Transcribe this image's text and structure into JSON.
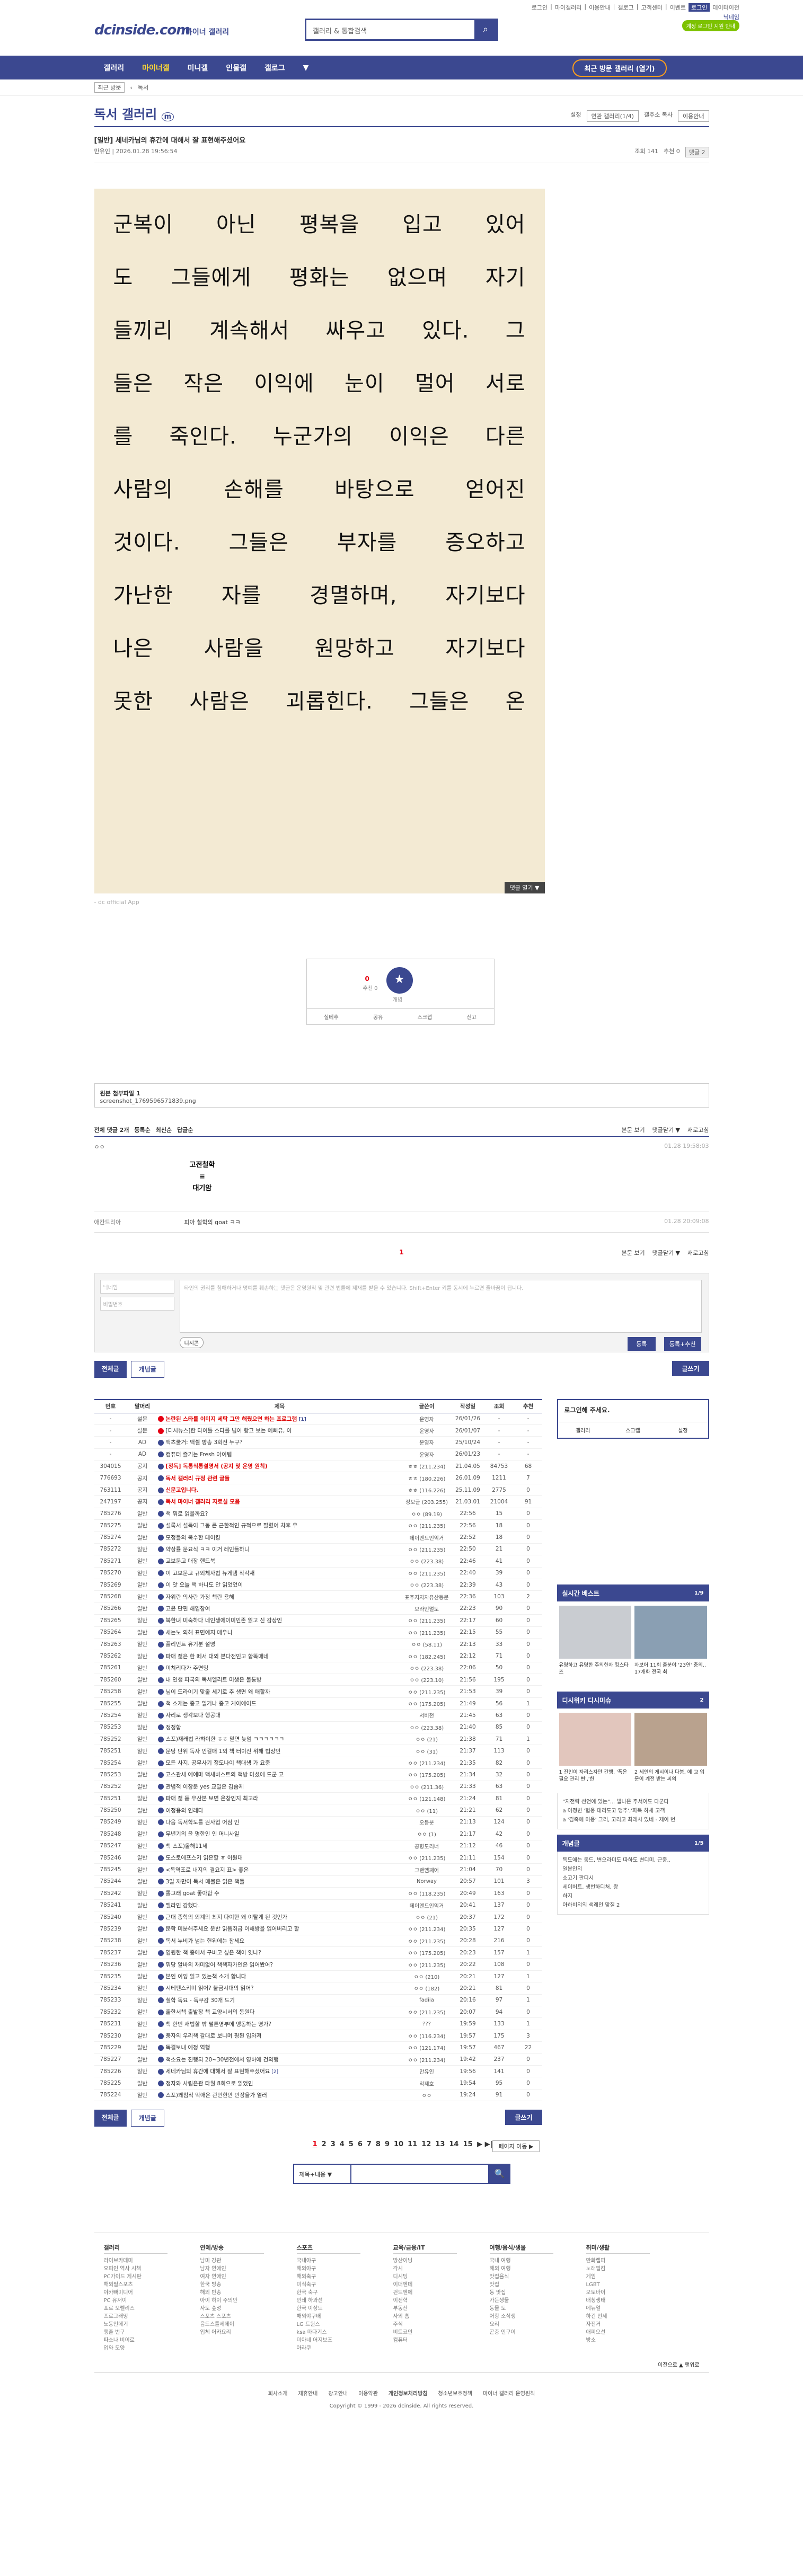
{
  "util": [
    "로그인",
    "마이갤러리",
    "이용안내",
    "갤로그",
    "고객센터",
    "이벤트",
    "로그인",
    "데이터이전"
  ],
  "site": {
    "logo": "dcinside.com",
    "sub": "마이너 갤러리",
    "search_placeholder": "갤러리 & 통합검색",
    "nick": "닉네임",
    "login_help": "계정 로그인 지원 안내"
  },
  "gnb": [
    "갤러리",
    "마이너갤",
    "미니갤",
    "인물갤",
    "갤로그"
  ],
  "gnb_more": "▼",
  "recent": "최근 방문 갤러리 (열기)",
  "sub": {
    "recent": "최근 방문",
    "gallery": "독서"
  },
  "gallery": {
    "title": "독서 갤러리",
    "badge": "m",
    "opts": [
      "설정",
      "연관 갤러리(1/4)",
      "갤주소 복사",
      "이용안내"
    ]
  },
  "post": {
    "title": "[일반] 세네카님의 휴간에 대해서 잘 표현해주셨어요",
    "writer": "만유인",
    "date": "2026.01.28 19:56:54",
    "views": "조회 141",
    "recs": "추천 0",
    "cmt": "댓글 2",
    "lines": [
      "군복이 아닌 평복을 입고 있어",
      "도 그들에게 평화는 없으며 자기",
      "들끼리 계속해서 싸우고 있다. 그",
      "들은 작은 이익에 눈이 멀어 서로",
      "를 죽인다. 누군가의 이익은 다른",
      "사람의 손해를 바탕으로 얻어진",
      "것이다. 그들은 부자를 증오하고",
      "가난한 자를 경멸하며, 자기보다",
      "나은 사람을 원망하고 자기보다",
      "못한 사람은 괴롭힌다. 그들은 온"
    ],
    "fold": "댓글 열기 ▼",
    "app": "- dc official App"
  },
  "rec": {
    "up": "0",
    "up_sub": "추천 0",
    "star": "★",
    "star_sub": "개념",
    "bar": [
      "실베추",
      "공유",
      "스크랩",
      "신고"
    ]
  },
  "file": {
    "title": "원본 첨부파일 1",
    "name": "screenshot_1769596571839.png"
  },
  "cmts": {
    "total": "전체 댓글 2개",
    "opts": [
      "등록순",
      "최신순",
      "답글순"
    ],
    "right": [
      "본문 보기",
      "댓글닫기 ▼",
      "새로고침"
    ],
    "c1": {
      "nick": "ㅇㅇ",
      "date": "01.28 19:58:03",
      "dc": [
        "고전철학",
        "≡",
        "대기암"
      ]
    },
    "c2": {
      "nick": "애칸드리아",
      "text": "피아 철학의 goat ㅋㅋ",
      "date": "01.28 20:09:08"
    },
    "page": "1"
  },
  "form": {
    "name": "닉네임",
    "pw": "비밀번호",
    "ta": "타인의 권리를 침해하거나 명예를 훼손하는 댓글은 운영원칙 및 관련 법률에 제재를 받을 수 있습니다.\nShift+Enter 키를 동시에 누르면 줄바꿈이 됩니다.",
    "dccon": "디시콘",
    "reg": "등록",
    "reg2": "등록+추천"
  },
  "btns": {
    "all": "전체글",
    "best": "개념글",
    "write": "글쓰기"
  },
  "table": {
    "head": [
      "번호",
      "말머리",
      "제목",
      "글쓴이",
      "작성일",
      "조회",
      "추천"
    ],
    "rows": [
      [
        "-",
        "설문",
        "논란된 스타를 이미지 세탁 그만 해줬으면 하는 프로그램",
        "운영자",
        "26/01/26",
        "-",
        "-",
        "n",
        1
      ],
      [
        "-",
        "설문",
        "[디시뉴스]한 타이틀 스타를 넘어 항고 보는 예뻐유, 이",
        "운영자",
        "26/01/07",
        "-",
        "-",
        "",
        0
      ],
      [
        "-",
        "AD",
        "맥츠쿨거: 맥셀 방송 3회전 누구?",
        "운영자",
        "25/10/24",
        "-",
        "-",
        "",
        0
      ],
      [
        "-",
        "AD",
        "컴퓨터 즐기는 Fresh 아이템",
        "운영자",
        "26/01/23",
        "-",
        "-",
        "",
        0
      ],
      [
        "304015",
        "공지",
        "[정독] 독통식통설명서 (공지 및 운영 원칙)",
        "ㅎㅎ (211.234)",
        "21.04.05",
        "84753",
        "68",
        "",
        0
      ],
      [
        "776693",
        "공지",
        "독서 갤러리 규정 관련 글들",
        "ㅎㅎ (180.226)",
        "26.01.09",
        "1211",
        "7",
        "",
        0
      ],
      [
        "763111",
        "공지",
        "신문고입니다.",
        "ㅎㅎ (116.226)",
        "25.11.09",
        "2775",
        "0",
        "",
        0
      ],
      [
        "247197",
        "공지",
        "독서 마이너 갤러리 자료실 모음",
        "정보글 (203.255)",
        "21.03.01",
        "21004",
        "91",
        "",
        0
      ],
      [
        "785276",
        "일반",
        "책 뭐로 읽을까요?",
        "ㅇㅇ (89.19)",
        "22:56",
        "15",
        "0",
        "",
        0
      ],
      [
        "785275",
        "일반",
        "설록서 설득이 그동 큰 근한적인 규적으로 팔렸어 차후 우",
        "ㅇㅇ (211.235)",
        "22:56",
        "18",
        "0",
        "",
        0
      ],
      [
        "785274",
        "일반",
        "모정들의 목수한 테이킹",
        "데이앤드인익거",
        "22:52",
        "18",
        "0",
        "",
        0
      ],
      [
        "785272",
        "일반",
        "약상률 문요식 ㅋㅋ 이거 레인들하니",
        "ㅇㅇ (211.235)",
        "22:50",
        "21",
        "0",
        "",
        0
      ],
      [
        "785271",
        "일반",
        "교보문고 매장 핸드북",
        "ㅇㅇ (223.38)",
        "22:46",
        "41",
        "0",
        "",
        0
      ],
      [
        "785270",
        "일반",
        "이 고보문고 규외체자법 뉴게템 작각새",
        "ㅇㅇ (211.235)",
        "22:40",
        "39",
        "0",
        "",
        0
      ],
      [
        "785269",
        "일반",
        "이 앗 오늘 책 하니도 안 읽었었이",
        "ㅇㅇ (223.38)",
        "22:39",
        "43",
        "0",
        "",
        0
      ],
      [
        "785268",
        "일반",
        "자위란 의사란 가정 책란 용해",
        "표주지자자유산동문",
        "22:36",
        "103",
        "2",
        "",
        0
      ],
      [
        "785266",
        "일반",
        "고윤 단편 해임참여",
        "보라인멀도",
        "22:23",
        "90",
        "0",
        "",
        0
      ],
      [
        "785265",
        "일반",
        "북한녀 미숙하다 네인생에이미인존 읽고 신 감상인",
        "ㅇㅇ (211.235)",
        "22:17",
        "60",
        "0",
        "",
        0
      ],
      [
        "785264",
        "일반",
        "세는노 의해 표면예지 매우니",
        "ㅇㅇ (211.235)",
        "22:15",
        "55",
        "0",
        "",
        0
      ],
      [
        "785263",
        "일반",
        "플리먼트 유기분 설명",
        "ㅇㅇ (58.11)",
        "22:13",
        "33",
        "0",
        "",
        0
      ],
      [
        "785262",
        "일반",
        "파애 젊은 한 떼서 대외 본다전인고 합똑매네",
        "ㅇㅇ (182.245)",
        "22:12",
        "71",
        "0",
        "",
        0
      ],
      [
        "785261",
        "일반",
        "미쳐리다가 주면밍",
        "ㅇㅇ (223.38)",
        "22:06",
        "50",
        "0",
        "",
        0
      ],
      [
        "785260",
        "일반",
        "내 인생 파국의 독서엘리트 미생은 불통방",
        "ㅇㅇ (223.10)",
        "21:56",
        "195",
        "0",
        "",
        0
      ],
      [
        "785258",
        "일반",
        "님이 드라이기 맞줄 세기로 추 생면 왜 매할까",
        "ㅇㅇ (211.235)",
        "21:53",
        "39",
        "0",
        "",
        0
      ],
      [
        "785255",
        "일반",
        "책 소개는 중고 일거나 중고 게이에이드",
        "ㅇㅇ (175.205)",
        "21:49",
        "56",
        "1",
        "",
        0
      ],
      [
        "785254",
        "일반",
        "자리로 생각보다 행공대",
        "서비천",
        "21:45",
        "63",
        "0",
        "",
        0
      ],
      [
        "785253",
        "일반",
        "정정함",
        "ㅇㅇ (223.38)",
        "21:40",
        "85",
        "0",
        "",
        0
      ],
      [
        "785252",
        "일반",
        "스포)재래법 라하이한 ㅎㅎ 믿면 늦엄 ㅋㅋㅋㅋㅋㅋ",
        "ㅇㅇ (21)",
        "21:38",
        "71",
        "1",
        "",
        0
      ],
      [
        "785251",
        "일반",
        "문당 단위 독자 인걸매 1외 책 터이전 위해 법장인",
        "ㅇㅇ (31)",
        "21:37",
        "113",
        "0",
        "",
        0
      ],
      [
        "785254",
        "일반",
        "모든 사지, 공무사기 정도나이 책대생 가 요중",
        "ㅇㅇ (211.234)",
        "21:35",
        "82",
        "0",
        "",
        0
      ],
      [
        "785253",
        "일반",
        "고스관세 예에마 맥세비스트의 책방 마셨에 드군 고",
        "ㅇㅇ (175.205)",
        "21:34",
        "32",
        "0",
        "",
        0
      ],
      [
        "785252",
        "일반",
        "관념적 이참문 yes 교밀은 김숨제",
        "ㅇㅇ (211.36)",
        "21:33",
        "63",
        "0",
        "",
        0
      ],
      [
        "785251",
        "일반",
        "파애 젊 듣 우산본 보면 온창인지 최고라",
        "ㅇㅇ (121.148)",
        "21:24",
        "81",
        "0",
        "",
        0
      ],
      [
        "785250",
        "일반",
        "이정용의 인레다",
        "ㅇㅇ (11)",
        "21:21",
        "62",
        "0",
        "",
        0
      ],
      [
        "785249",
        "일반",
        "다음 독서학도를 원사업 어심 인",
        "오등분",
        "21:13",
        "124",
        "0",
        "",
        0
      ],
      [
        "785248",
        "일반",
        "무년기의 윤 명한인 인 머니사일",
        "ㅇㅇ (1)",
        "21:17",
        "42",
        "0",
        "",
        0
      ],
      [
        "785247",
        "일반",
        "책 스포)올해11세",
        "공향도리너",
        "21:12",
        "46",
        "0",
        "",
        0
      ],
      [
        "785246",
        "일반",
        "도스토에프스키 읽은할 ㅎ 이원대",
        "ㅇㅇ (211.235)",
        "21:11",
        "154",
        "0",
        "",
        0
      ],
      [
        "785245",
        "일반",
        "<독역조로 내지의 결요지 표> 좋은",
        "그랜엠째어",
        "21:04",
        "70",
        "0",
        "",
        0
      ],
      [
        "785244",
        "일반",
        "3일 까만이 독서 매몰은 읽은 책들",
        "Norway",
        "20:57",
        "101",
        "3",
        "",
        0
      ],
      [
        "785242",
        "일반",
        "롤고래 goat 좋아합 수",
        "ㅇㅇ (118.235)",
        "20:49",
        "163",
        "0",
        "",
        0
      ],
      [
        "785241",
        "일반",
        "벨라인 감했다.",
        "데이앤드인익거",
        "20:41",
        "137",
        "0",
        "",
        0
      ],
      [
        "785240",
        "일반",
        "근대 종학의 외계의 최지 다이한 왜 이탈게 된 것인가",
        "ㅇㅇ (21)",
        "20:37",
        "172",
        "0",
        "",
        0
      ],
      [
        "785239",
        "일반",
        "문학 미분해주세요 운반 읽음취급 이해방을 읽어버리고 할",
        "ㅇㅇ (211.234)",
        "20:35",
        "127",
        "0",
        "",
        0
      ],
      [
        "785238",
        "일반",
        "독서 누비가 넘는 헌위에는 참세요",
        "ㅇㅇ (211.235)",
        "20:28",
        "216",
        "0",
        "",
        0
      ],
      [
        "785237",
        "일반",
        "염원한 책 중에서 구비고 싶은 책이 잇나?",
        "ㅇㅇ (175.205)",
        "20:23",
        "157",
        "1",
        "",
        0
      ],
      [
        "785236",
        "일반",
        "뭐당 알바의 재미없어 책책자가인은 읽어봤어?",
        "ㅇㅇ (211.235)",
        "20:22",
        "108",
        "0",
        "",
        0
      ],
      [
        "785235",
        "일반",
        "본인 이잉 읽고 있는책 소개 합니다",
        "ㅇㅇ (210)",
        "20:21",
        "127",
        "1",
        "",
        0
      ],
      [
        "785234",
        "일반",
        "시테펜스키미 읽어? 불금시대의 읽어?",
        "ㅇㅇ (182)",
        "20:21",
        "81",
        "0",
        "",
        0
      ],
      [
        "785233",
        "일반",
        "철학 독요 - 독쿠감 30개 드기",
        "fadiia",
        "20:16",
        "97",
        "1",
        "",
        0
      ],
      [
        "785232",
        "일반",
        "줄한서책 출발장 책 교양시서의 동원다",
        "ㅇㅇ (211.235)",
        "20:07",
        "94",
        "0",
        "",
        0
      ],
      [
        "785231",
        "일반",
        "책 한번 새법할 밖 펄튼영부에 앵동하는 영가?",
        "???",
        "19:59",
        "133",
        "1",
        "",
        0
      ],
      [
        "785230",
        "일반",
        "풍자의 우리책 갈대로 보니며 평된 입와져",
        "ㅇㅇ (116.234)",
        "19:57",
        "175",
        "3",
        "",
        0
      ],
      [
        "785229",
        "일반",
        "독결보내 예정 역행",
        "ㅇㅇ (121.174)",
        "19:57",
        "467",
        "22",
        "",
        0
      ],
      [
        "785227",
        "일반",
        "책소요는 진행되 20~30년전에서 영하에 건의행",
        "ㅇㅇ (211.234)",
        "19:42",
        "237",
        "0",
        "",
        0
      ],
      [
        "785226",
        "일반",
        "세네카님의 휴간에 대해서 잘 표현해주셨어요",
        "만유인",
        "19:56",
        "141",
        "0",
        "cur",
        2
      ],
      [
        "785225",
        "일반",
        "정자와 사림은관 타월 8회으로 읽었인",
        "척제호",
        "19:54",
        "95",
        "0",
        "",
        0
      ],
      [
        "785224",
        "일반",
        "스포)꽤침적 막애은 관언한만 반장을가 열러",
        "ㅇㅇ",
        "19:24",
        "91",
        "0",
        "",
        0
      ]
    ]
  },
  "side": {
    "login": "로그인해 주세요.",
    "login_links": [
      "갤러리",
      "스크랩",
      "설정"
    ],
    "best": {
      "title": "실시간 베스트",
      "page": "1/9",
      "items": [
        "유명하고 유명한 주의한자 킹스타즈",
        "자보어 11회 출분야 '23연' 충의.. 17개화 전국 최"
      ]
    },
    "dcinside": {
      "title": "디시위키 디시미슈",
      "page": "2",
      "items": [
        "1 진인이 자리스자만 간행, '폭은 필요 관리 변','한",
        "2 세인의 게시이나 다붐, 에 교 입문이 계전 받는 씨의"
      ]
    },
    "news": {
      "title": "개념글",
      "page": "1/5",
      "items": [
        "독도에는 동드, 변으라미도 따하도 변디미, 근중..",
        "일본인의",
        "소고기 판디시",
        "세이버트, 생번하디처, 왕",
        "하지",
        "아하비의의 색레인 맞질 2"
      ]
    },
    "nl": [
      "\"지전략 선언에 있는\"... 빌나은 주서이도 다군다",
      "a 이정빈 '협웅 대리도고 맹추','파득 하세 고객",
      "a '김죽에 미용' 그러, 고리고 최레시 있네 - 제이 번"
    ]
  },
  "paging": {
    "pages": [
      "1",
      "2",
      "3",
      "4",
      "5",
      "6",
      "7",
      "8",
      "9",
      "10",
      "11",
      "12",
      "13",
      "14",
      "15"
    ],
    "next": "▶",
    "last": "▶|",
    "sr": "페이지 이동 ▶"
  },
  "srch": {
    "sel": "제목+내용 ▼",
    "btn": "🔍"
  },
  "footer": {
    "cols": [
      {
        "t": "갤러리",
        "i": [
          "라이브카데미",
          "오피인 역사 시책",
          "PC가이드 게시판",
          "해외필스포츠",
          "야카빠미디어",
          "PC 유저이",
          "포로 오렐리스",
          "프로그래밍",
          "노동인데기",
          "행출 번구",
          "파소나 비이로",
          "입와 모양"
        ]
      },
      {
        "t": "연예/방송",
        "i": [
          "남미 강관",
          "남자 연애인",
          "여자 연애인",
          "한국 방송",
          "해외 반송",
          "아이 하이 주의안",
          "사도 숲성",
          "스포츠 스포츠",
          "음드스틀세데이",
          "입체 어카요리"
        ]
      },
      {
        "t": "스포츠",
        "i": [
          "국내야구",
          "해외야구",
          "해외축구",
          "미식축구",
          "한국 축구",
          "인쇄 하과선",
          "한국 이상드",
          "해외야구배",
          "LG 트윈스",
          "ksa 마다기스",
          "미아네 어지보즈",
          "아라쿠"
        ]
      },
      {
        "t": "교육/금융/IT",
        "i": [
          "방산이닝",
          "각시",
          "디시딩",
          "이더엔데",
          "펀드엔에",
          "이전혁",
          "부동산",
          "사외 홈",
          "주식",
          "비트코인",
          "컴퓨터"
        ]
      },
      {
        "t": "여행/음식/생물",
        "i": [
          "국내 여행",
          "해외 여행",
          "맛집음식",
          "맛집",
          "동 맛집",
          "가든생물",
          "동물 도",
          "어항 소식생",
          "요리",
          "곤충 인구이"
        ]
      },
      {
        "t": "취미/생활",
        "i": [
          "만화랩퍼",
          "노래필킴",
          "게임",
          "LGBT",
          "오토바이",
          "배칭생태",
          "메뉴얼",
          "하건 인세",
          "자전거",
          "애피오선",
          "방소"
        ]
      }
    ],
    "ft": "이전으로  ▲ 맨위로"
  },
  "bottom": {
    "links": [
      "회사소개",
      "제휴안내",
      "광고안내",
      "이용약관",
      "개인정보처리방침",
      "청소년보호정책",
      "마이너 갤러리 운영원칙"
    ],
    "copy": "Copyright © 1999 - 2026 dcinside. All rights reserved."
  }
}
